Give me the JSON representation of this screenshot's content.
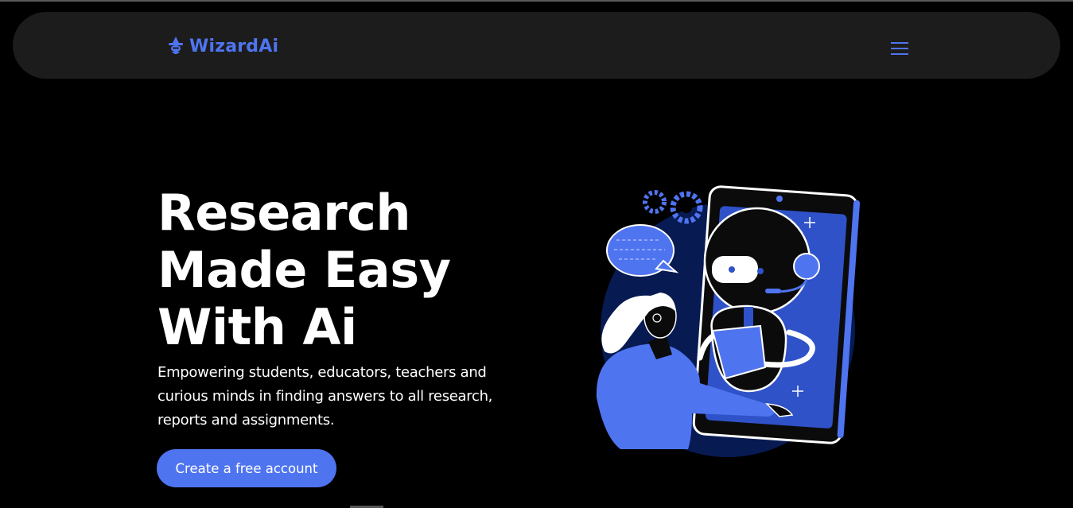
{
  "header": {
    "brand_name": "WizardAi",
    "logo_icon": "wizard-icon",
    "menu_icon": "hamburger-menu-icon",
    "accent_color": "#4f74f0"
  },
  "hero": {
    "title_lines": [
      "Research",
      "Made Easy",
      "With Ai"
    ],
    "subtitle": "Empowering students, educators, teachers and curious minds in finding answers to all research, reports and assignments.",
    "cta_label": "Create a free account"
  },
  "illustration": {
    "subject": "robot-assistant-illustration"
  }
}
